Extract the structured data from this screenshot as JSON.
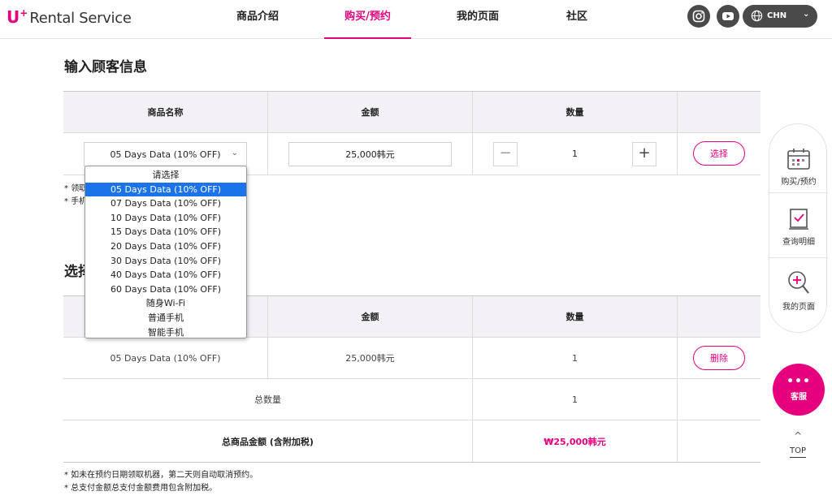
{
  "header": {
    "logo": {
      "u": "U",
      "plus": "+",
      "text": "Rental Service"
    },
    "nav": [
      "商品介绍",
      "购买/预约",
      "我的页面",
      "社区"
    ],
    "active_nav": "购买/预约",
    "social": [
      "instagram-icon",
      "youtube-icon"
    ],
    "language": "CHN"
  },
  "input_section": {
    "title": "输入顾客信息",
    "columns": [
      "商品名称",
      "金额",
      "数量"
    ],
    "selected_product": "05 Days Data (10% OFF)",
    "amount": "25,000韩元",
    "quantity": "1",
    "minus": "−",
    "plus": "+",
    "select_button": "选择",
    "notes": [
      "领取",
      "手机"
    ]
  },
  "dropdown": {
    "options": [
      "请选择",
      "05 Days Data (10% OFF)",
      "07 Days Data (10% OFF)",
      "10 Days Data (10% OFF)",
      "15 Days Data (10% OFF)",
      "20 Days Data (10% OFF)",
      "30 Days Data (10% OFF)",
      "40 Days Data (10% OFF)",
      "60 Days Data (10% OFF)",
      "随身Wi-Fi",
      "普通手机",
      "智能手机"
    ],
    "selected_index": 1
  },
  "selected_section": {
    "title": "选择",
    "columns": [
      "金额",
      "数量"
    ],
    "item": {
      "name": "05 Days Data (10% OFF)",
      "amount": "25,000韩元",
      "quantity": "1",
      "delete_button": "删除"
    },
    "total_quantity_label": "总数量",
    "total_quantity": "1",
    "total_amount_label": "总商品金额 (含附加税)",
    "total_amount": "₩25,000韩元"
  },
  "footer_notes": [
    "* 如未在预约日期领取机器，第二天则自动取消预约。",
    "* 总支付金额总支付金额费用包含附加税。"
  ],
  "quick_menu": {
    "items": [
      {
        "label": "购买/预约",
        "icon": "calendar-icon"
      },
      {
        "label": "查询明细",
        "icon": "checklist-icon"
      },
      {
        "label": "我的页面",
        "icon": "magnifier-plus-icon"
      }
    ],
    "chat": {
      "dots": "•••",
      "label": "客服"
    },
    "top": {
      "arrow": "^",
      "label": "TOP"
    }
  },
  "colors": {
    "brand": "#e6007e",
    "header_bg": "#f4f1f6",
    "dropdown_highlight": "#1a73e8"
  }
}
